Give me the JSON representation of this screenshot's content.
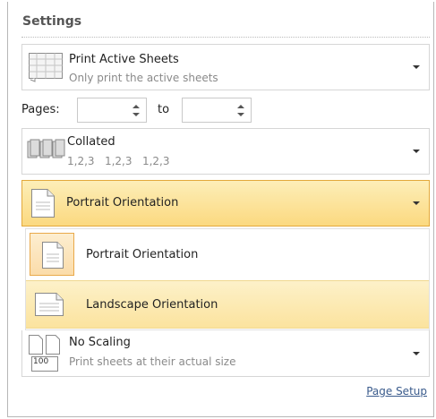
{
  "settings": {
    "title": "Settings",
    "print_what": {
      "label": "Print Active Sheets",
      "sublabel": "Only print the active sheets"
    },
    "pages": {
      "label": "Pages:",
      "from_value": "",
      "to_label": "to",
      "to_value": ""
    },
    "collation": {
      "label": "Collated",
      "sublabel": "1,2,3   1,2,3   1,2,3"
    },
    "orientation": {
      "selected": "Portrait Orientation",
      "options": [
        {
          "label": "Portrait Orientation",
          "icon": "portrait-page-icon"
        },
        {
          "label": "Landscape Orientation",
          "icon": "landscape-page-icon",
          "hovered": true
        }
      ]
    },
    "scaling": {
      "label": "No Scaling",
      "sublabel": "Print sheets at their actual size",
      "badge": "100"
    },
    "page_setup_link": "Page Setup"
  },
  "colors": {
    "highlight_border": "#e3a93b",
    "highlight_bg": "#fbd980",
    "hover_bg": "#fbe39e",
    "link": "#3a5b8c"
  }
}
